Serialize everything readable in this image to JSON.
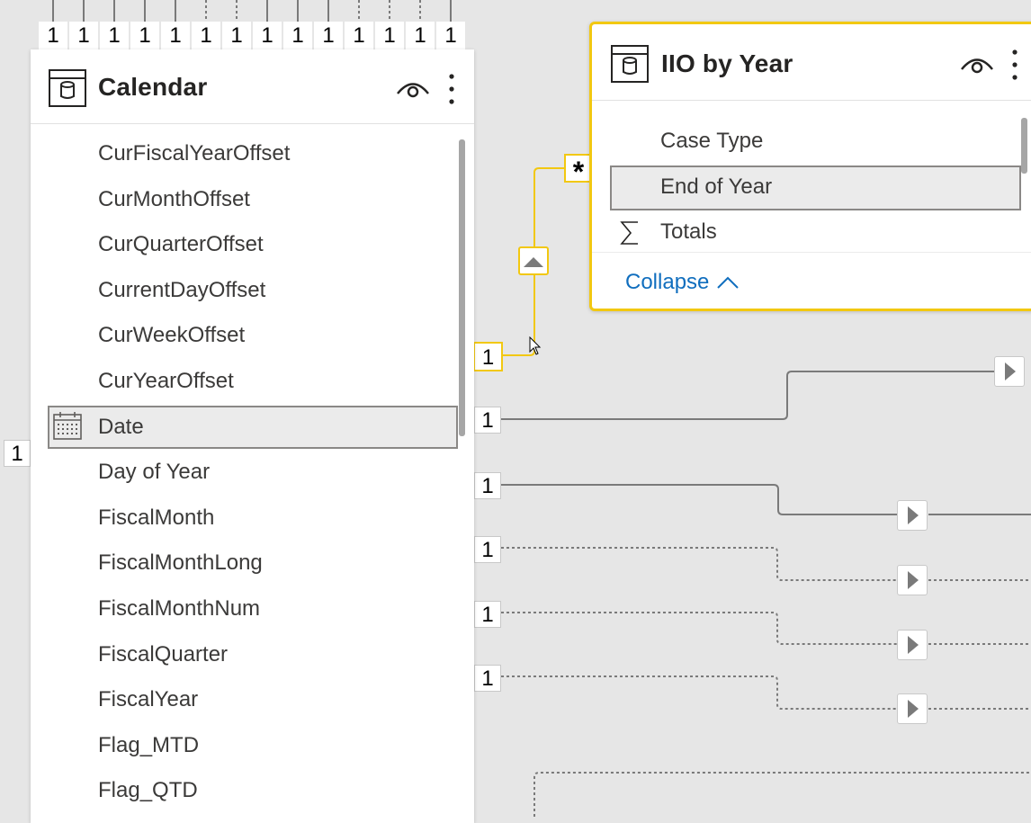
{
  "calendar_table": {
    "title": "Calendar",
    "fields": [
      {
        "label": "CurFiscalYearOffset",
        "icon": "",
        "selected": false
      },
      {
        "label": "CurMonthOffset",
        "icon": "",
        "selected": false
      },
      {
        "label": "CurQuarterOffset",
        "icon": "",
        "selected": false
      },
      {
        "label": "CurrentDayOffset",
        "icon": "",
        "selected": false
      },
      {
        "label": "CurWeekOffset",
        "icon": "",
        "selected": false
      },
      {
        "label": "CurYearOffset",
        "icon": "",
        "selected": false
      },
      {
        "label": "Date",
        "icon": "calendar-icon",
        "selected": true
      },
      {
        "label": "Day of Year",
        "icon": "",
        "selected": false
      },
      {
        "label": "FiscalMonth",
        "icon": "",
        "selected": false
      },
      {
        "label": "FiscalMonthLong",
        "icon": "",
        "selected": false
      },
      {
        "label": "FiscalMonthNum",
        "icon": "",
        "selected": false
      },
      {
        "label": "FiscalQuarter",
        "icon": "",
        "selected": false
      },
      {
        "label": "FiscalYear",
        "icon": "",
        "selected": false
      },
      {
        "label": "Flag_MTD",
        "icon": "",
        "selected": false
      },
      {
        "label": "Flag_QTD",
        "icon": "",
        "selected": false
      }
    ]
  },
  "iio_table": {
    "title": "IIO by Year",
    "fields": [
      {
        "label": "Case Type",
        "icon": "",
        "selected": false
      },
      {
        "label": "End of Year",
        "icon": "",
        "selected": true
      },
      {
        "label": "Totals",
        "icon": "sigma-icon",
        "selected": false
      }
    ],
    "collapse_label": "Collapse"
  },
  "cardinality": {
    "top_row": [
      "1",
      "1",
      "1",
      "1",
      "1",
      "1",
      "1",
      "1",
      "1",
      "1",
      "1",
      "1",
      "1",
      "1"
    ],
    "left_edge": "1",
    "highlighted_one": "1",
    "highlighted_many": "*",
    "relationship_ones": [
      "1",
      "1",
      "1",
      "1",
      "1"
    ]
  },
  "colors": {
    "canvas": "#e6e6e6",
    "highlight": "#f2c811",
    "link": "#106ebe",
    "selected_row": "#ebebeb"
  }
}
